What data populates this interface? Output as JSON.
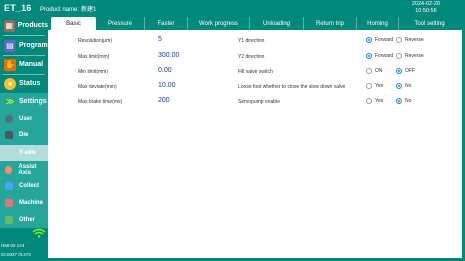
{
  "app": {
    "title": "ET_16",
    "product_label": "Product name:",
    "product_value": "新建1",
    "date": "2024-02-20",
    "time": "10:50:56"
  },
  "sidebar": {
    "main_items": [
      {
        "label": "Products",
        "icon": "products-icon"
      },
      {
        "label": "Program",
        "icon": "program-icon"
      },
      {
        "label": "Manual",
        "icon": "manual-icon"
      },
      {
        "label": "Status",
        "icon": "status-icon"
      },
      {
        "label": "Settings",
        "icon": "settings-chevron-icon"
      }
    ],
    "sub_items": [
      {
        "label": "User",
        "icon": "user-icon"
      },
      {
        "label": "Die",
        "icon": "die-icon"
      },
      {
        "label": "Y-axis",
        "icon": "y-axis-icon"
      },
      {
        "label": "Assist Axis",
        "icon": "assist-axis-icon"
      },
      {
        "label": "Collect",
        "icon": "collect-icon"
      },
      {
        "label": "Machine",
        "icon": "machine-icon"
      },
      {
        "label": "Other",
        "icon": "other-icon"
      }
    ],
    "footer_line1": "HMI:02.124",
    "footer_line2": "IO:0027 /3.473"
  },
  "tabs": [
    "Basic",
    "Pressure",
    "Faster",
    "Work progress",
    "Unloading",
    "Return trip",
    "Homing",
    "Tool setting"
  ],
  "left_fields": [
    {
      "label": "Resolution(μm)",
      "value": "5"
    },
    {
      "label": "Max limit(mm)",
      "value": "300.00"
    },
    {
      "label": "Min limit(mm)",
      "value": "0.00"
    },
    {
      "label": "Max deviate(mm)",
      "value": "10.00"
    },
    {
      "label": "Max brake time(ms)",
      "value": "200"
    }
  ],
  "right_fields": [
    {
      "label": "Y1 direction",
      "opt1": "Forward",
      "opt2": "Reverse",
      "selected": 1
    },
    {
      "label": "Y2 direction",
      "opt1": "Forward",
      "opt2": "Reverse",
      "selected": 1
    },
    {
      "label": "Fill valve switch",
      "opt1": "ON",
      "opt2": "OFF",
      "selected": 2
    },
    {
      "label": "Loose foot whether to close the slow down valve",
      "opt1": "Yes",
      "opt2": "No",
      "selected": 2
    },
    {
      "label": "Servopump enable",
      "opt1": "Yes",
      "opt2": "No",
      "selected": 2
    }
  ],
  "colors": {
    "primary": "#00897b",
    "accent": "#26a69a",
    "value_blue": "#1a3ea8",
    "radio_on": "#1e88e5"
  }
}
